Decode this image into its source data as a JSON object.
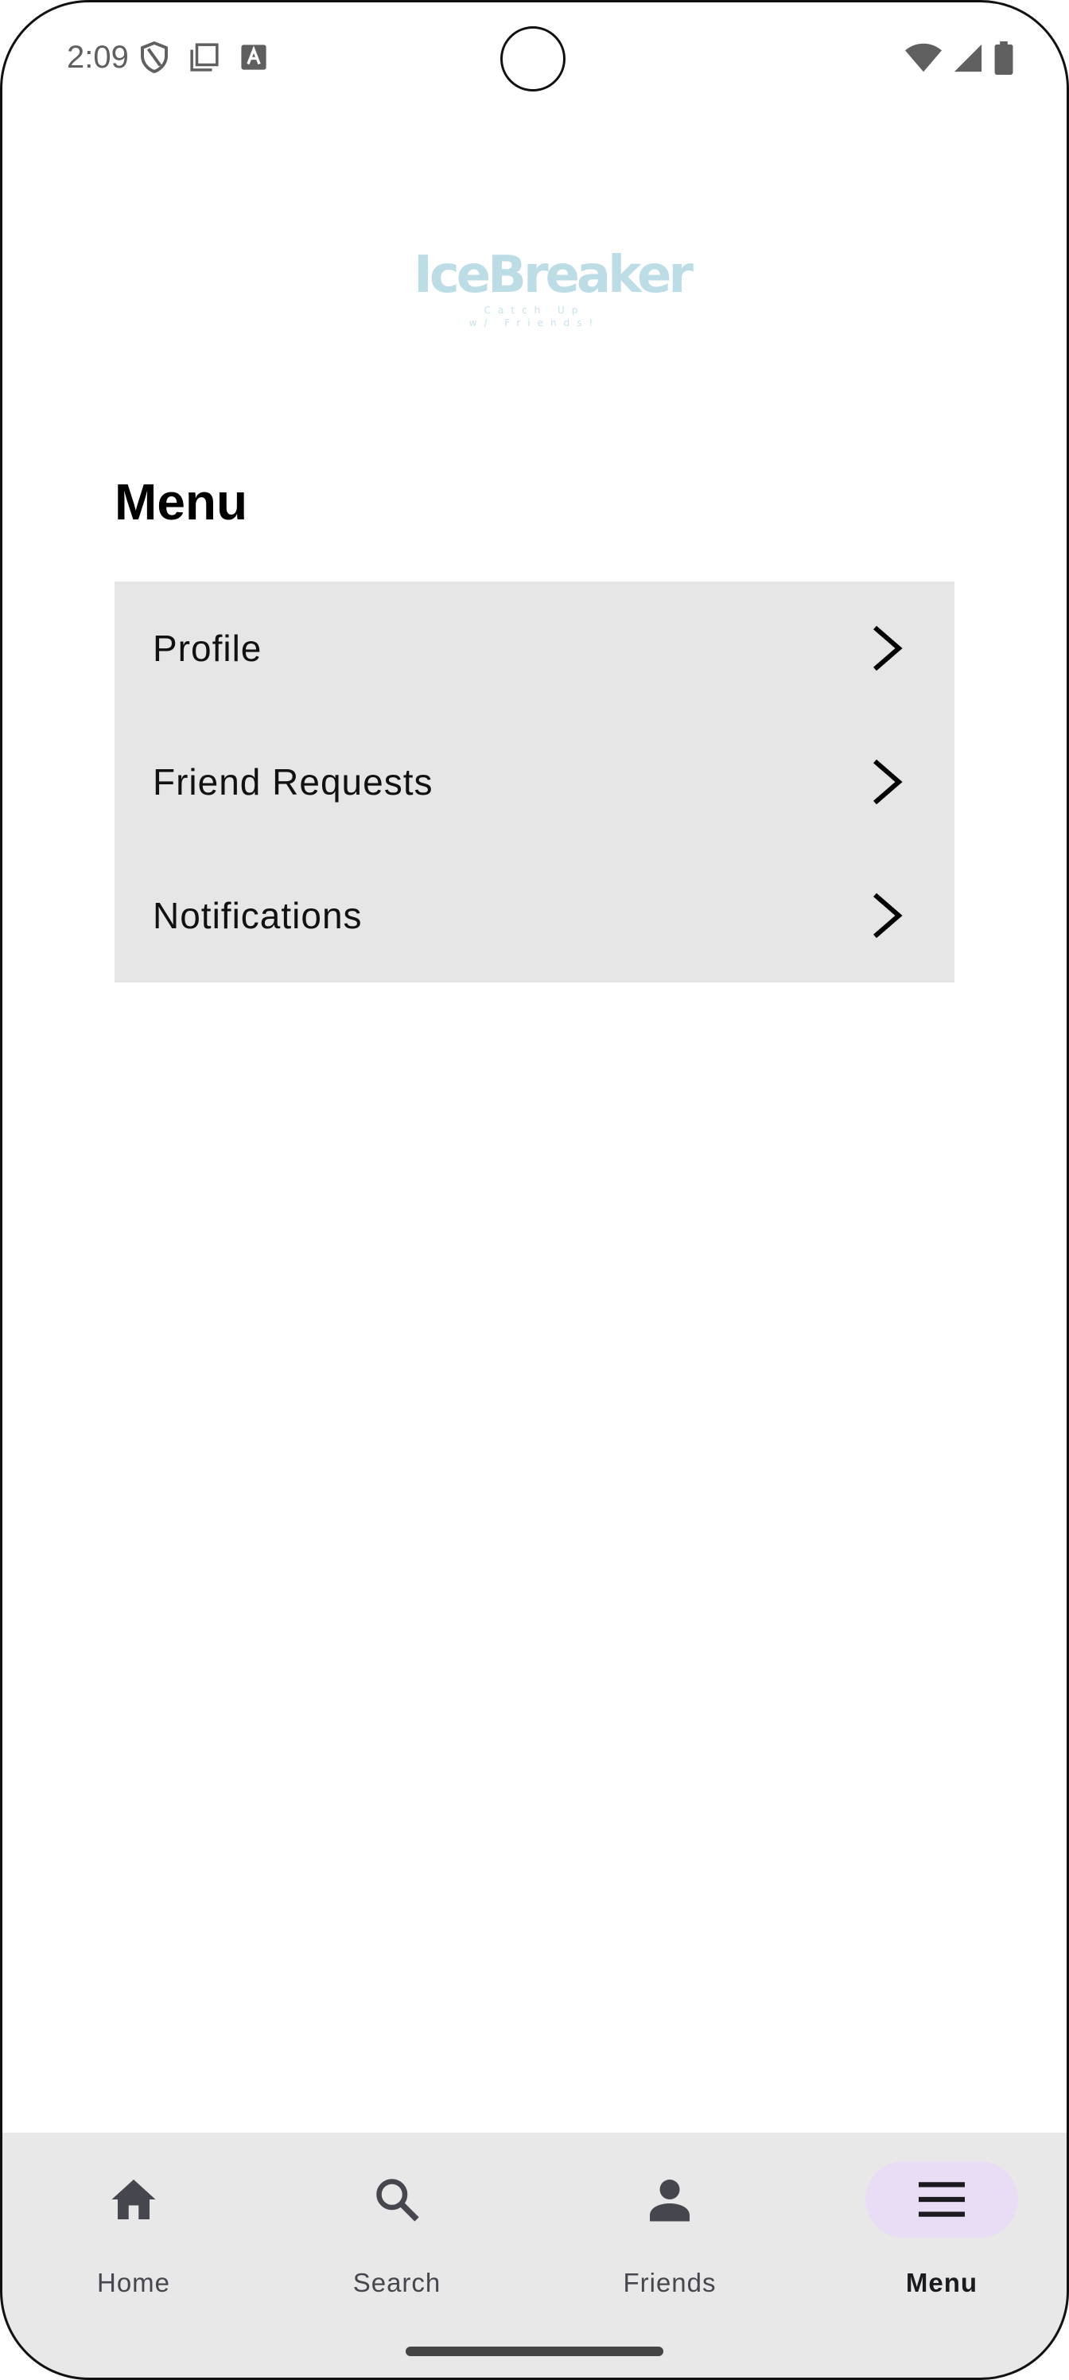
{
  "status_bar": {
    "time": "2:09",
    "left_icons": [
      "shield-icon",
      "clipboard-icon",
      "text-a-icon"
    ],
    "right_icons": [
      "wifi-icon",
      "cellular-signal-icon",
      "battery-icon"
    ]
  },
  "logo": {
    "title": "IceBreaker",
    "subtitle_line1": "Catch Up",
    "subtitle_line2": "w/ Friends!",
    "color": "#bcdde6"
  },
  "page": {
    "title": "Menu"
  },
  "menu": {
    "items": [
      {
        "label": "Profile",
        "icon": "chevron-right-icon"
      },
      {
        "label": "Friend Requests",
        "icon": "chevron-right-icon"
      },
      {
        "label": "Notifications",
        "icon": "chevron-right-icon"
      }
    ],
    "background": "#e6e6e6"
  },
  "bottom_nav": {
    "items": [
      {
        "label": "Home",
        "icon": "home-icon",
        "active": false
      },
      {
        "label": "Search",
        "icon": "search-icon",
        "active": false
      },
      {
        "label": "Friends",
        "icon": "person-icon",
        "active": false
      },
      {
        "label": "Menu",
        "icon": "menu-icon",
        "active": true
      }
    ],
    "active_pill_color": "#e9ddf6",
    "background": "#e8e8e8"
  }
}
